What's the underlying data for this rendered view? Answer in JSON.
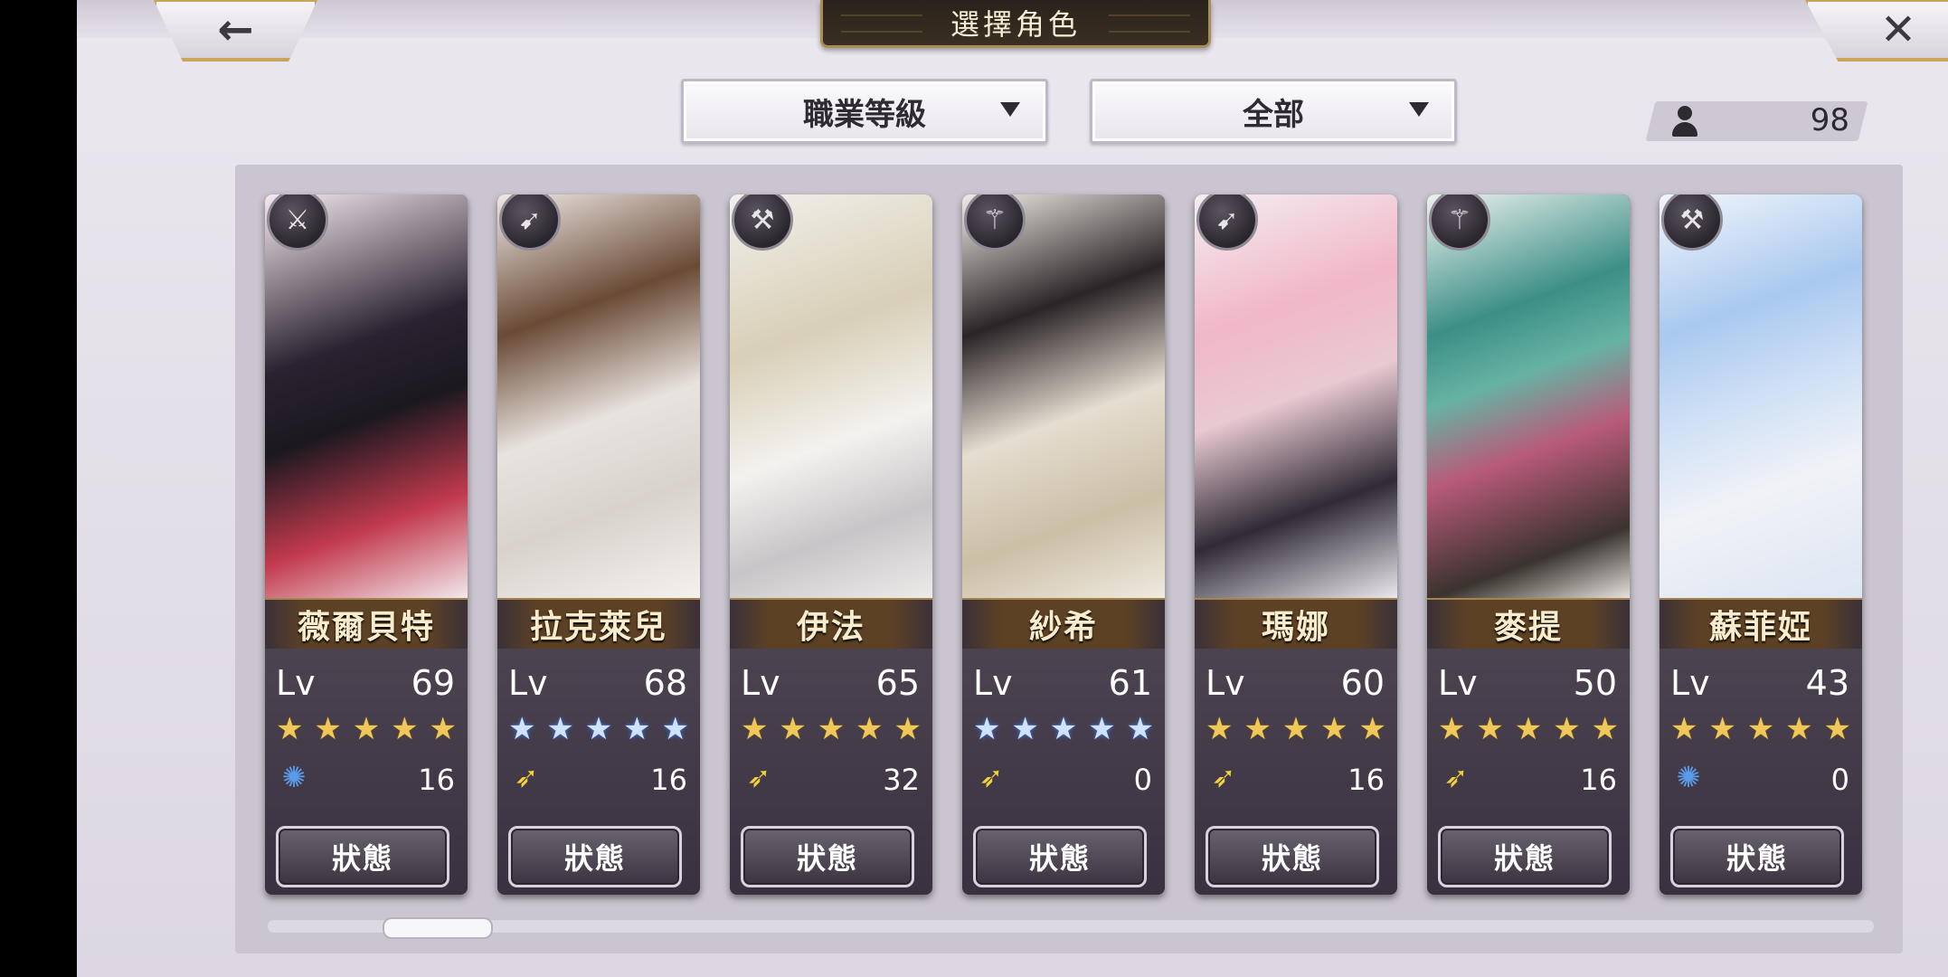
{
  "header": {
    "title": "選擇角色",
    "back_label": "←",
    "close_label": "✕"
  },
  "filters": {
    "job_level": "職業等級",
    "category": "全部"
  },
  "roster_count": "98",
  "lv_label": "Lv",
  "status_label": "狀態",
  "colors": {
    "gold_star": "#f0c85a",
    "blue_star": "#cfe3ff",
    "accent_border": "#c9a45a"
  },
  "characters": [
    {
      "name": "薇爾貝特",
      "level": "69",
      "rarity_count": 5,
      "star_color": "gold",
      "element": "wind-icon",
      "element_value": "16",
      "class_icon": "sword-icon"
    },
    {
      "name": "拉克萊兒",
      "level": "68",
      "rarity_count": 5,
      "star_color": "blue",
      "element": "light-icon",
      "element_value": "16",
      "class_icon": "bow-icon"
    },
    {
      "name": "伊法",
      "level": "65",
      "rarity_count": 5,
      "star_color": "gold",
      "element": "light-icon",
      "element_value": "32",
      "class_icon": "hammer-icon"
    },
    {
      "name": "紗希",
      "level": "61",
      "rarity_count": 5,
      "star_color": "blue",
      "element": "light-icon",
      "element_value": "0",
      "class_icon": "staff-icon"
    },
    {
      "name": "瑪娜",
      "level": "60",
      "rarity_count": 5,
      "star_color": "gold",
      "element": "light-icon",
      "element_value": "16",
      "class_icon": "bow-icon"
    },
    {
      "name": "麥提",
      "level": "50",
      "rarity_count": 5,
      "star_color": "gold",
      "element": "light-icon",
      "element_value": "16",
      "class_icon": "staff-icon"
    },
    {
      "name": "蘇菲婭",
      "level": "43",
      "rarity_count": 5,
      "star_color": "gold",
      "element": "wind-icon",
      "element_value": "0",
      "class_icon": "axe-icon"
    }
  ]
}
